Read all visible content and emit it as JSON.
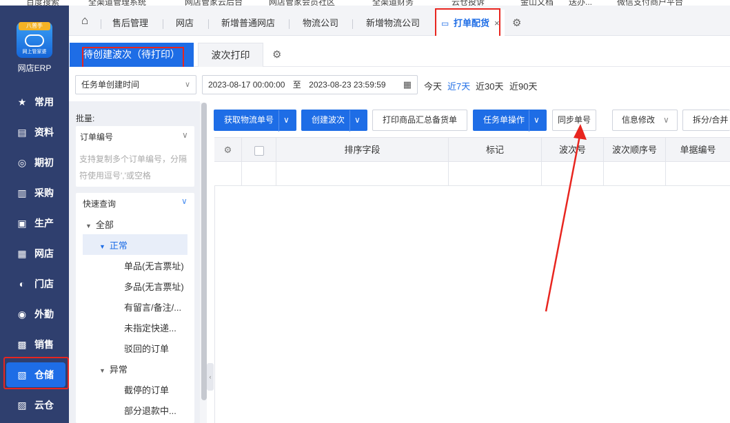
{
  "bookmarks": [
    "百度搜索",
    "全渠道管理系统",
    "网店管家云后台",
    "网店管家会员社区",
    "全渠道财务",
    "云仓投诉",
    "金山文档",
    "送办...",
    "微信支付商户平台"
  ],
  "sidebar": {
    "logo_badge": "八普手",
    "logo_sub": "网上管家婆",
    "brand": "网店ERP",
    "items": [
      {
        "label": "常用",
        "icon": "★"
      },
      {
        "label": "资料",
        "icon": "▤"
      },
      {
        "label": "期初",
        "icon": "◎"
      },
      {
        "label": "采购",
        "icon": "▥"
      },
      {
        "label": "生产",
        "icon": "▣"
      },
      {
        "label": "网店",
        "icon": "▦"
      },
      {
        "label": "门店",
        "icon": "◐"
      },
      {
        "label": "外勤",
        "icon": "◉"
      },
      {
        "label": "销售",
        "icon": "▩"
      },
      {
        "label": "仓储",
        "icon": "▧"
      },
      {
        "label": "云仓",
        "icon": "▨"
      }
    ]
  },
  "tabbar": {
    "home_icon": "⌂",
    "tabs": [
      "售后管理",
      "网店",
      "新增普通网店",
      "物流公司",
      "新增物流公司"
    ],
    "active": "打单配货",
    "active_icon": "▭",
    "close": "×",
    "gear": "⚙"
  },
  "subtabs": {
    "active": "待创建波次（待打印）",
    "second": "波次打印",
    "gear": "⚙"
  },
  "filters": {
    "time_type": "任务单创建时间",
    "date_start": "2023-08-17 00:00:00",
    "date_sep": "至",
    "date_end": "2023-08-23 23:59:59",
    "calendar_icon": "▦",
    "quick": [
      "今天",
      "近7天",
      "近30天",
      "近90天"
    ]
  },
  "left_panel": {
    "batch_label": "批量:",
    "order_select": "订单编号",
    "order_hint": "支持复制多个订单编号，分隔符使用逗号','或空格",
    "quick_title": "快速查询",
    "tree": {
      "all": "全部",
      "normal": "正常",
      "normal_children": [
        "单品(无言票址)",
        "多品(无言票址)",
        "有留言/备注/...",
        "未指定快递...",
        "驳回的订单"
      ],
      "abnormal": "异常",
      "abnormal_children": [
        "截停的订单",
        "部分退款中..."
      ]
    }
  },
  "toolbar": {
    "get_tracking": "获取物流单号",
    "create_wave": "创建波次",
    "print_summary": "打印商品汇总备货单",
    "task_ops": "任务单操作",
    "sync_no": "同步单号",
    "info_edit": "信息修改",
    "split_merge": "拆分/合并",
    "dropdown_icon": "∨"
  },
  "grid": {
    "columns": [
      "排序字段",
      "标记",
      "波次号",
      "波次顺序号",
      "单据编号"
    ],
    "gear": "⚙"
  },
  "colors": {
    "sidebar": "#2f3f6e",
    "primary": "#1e6de6",
    "annotation_red": "#e8251f"
  }
}
